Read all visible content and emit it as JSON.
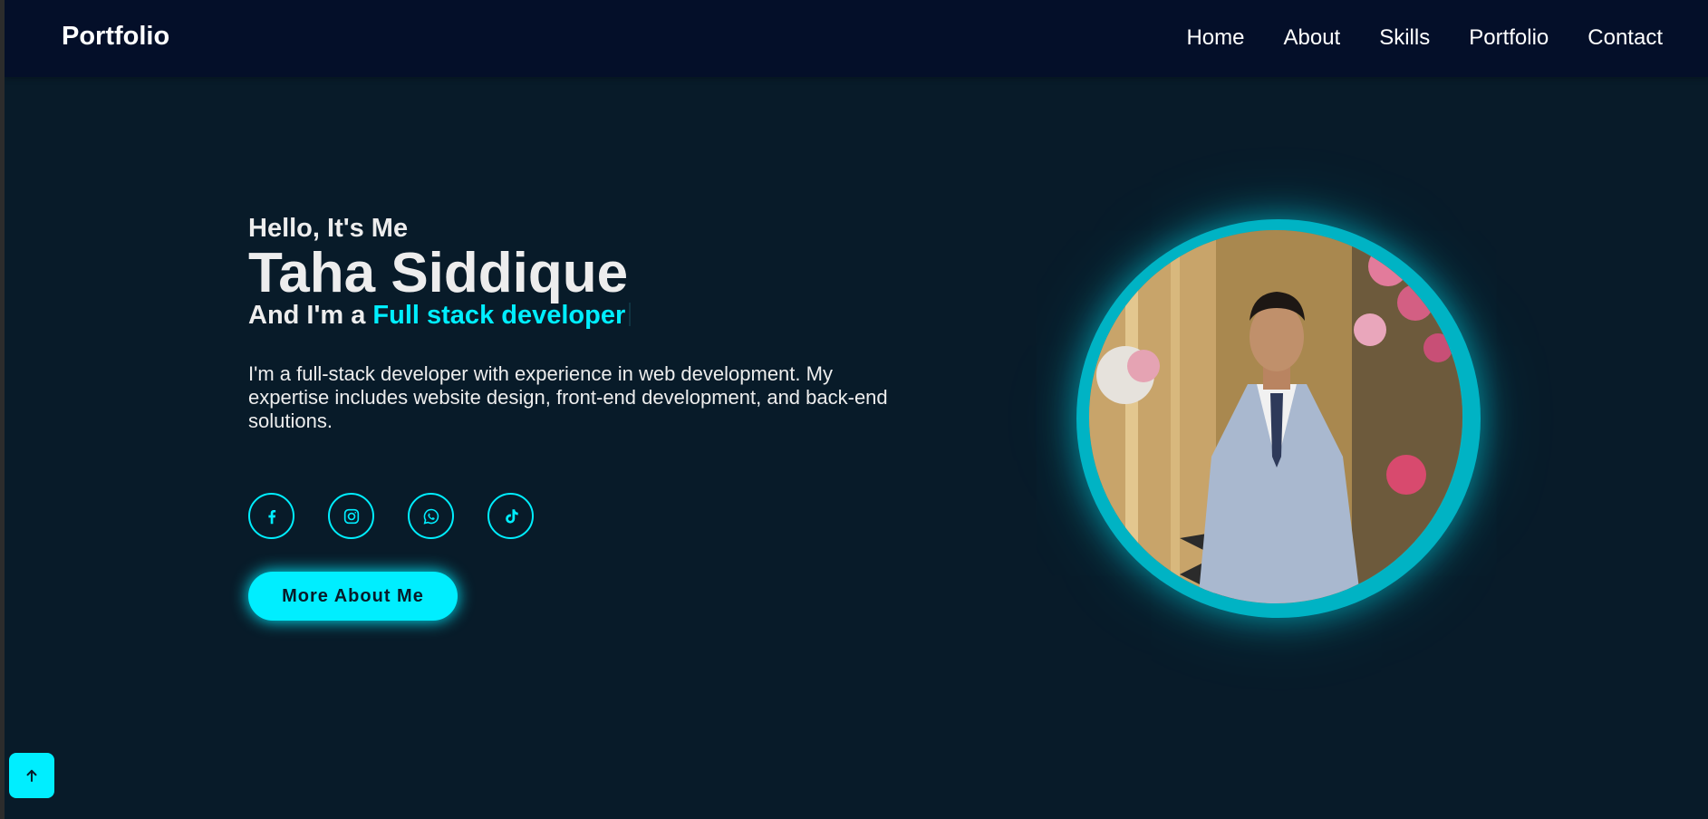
{
  "navbar": {
    "logo": "Portfolio",
    "links": [
      "Home",
      "About",
      "Skills",
      "Portfolio",
      "Contact"
    ]
  },
  "hero": {
    "greeting": "Hello, It's Me",
    "name": "Taha Siddique",
    "role_prefix": "And I'm a ",
    "role": "Full stack developer",
    "bio": "I'm a full-stack developer with experience in web development. My expertise includes website design, front-end development, and back-end solutions.",
    "socials": [
      {
        "icon": "facebook-icon"
      },
      {
        "icon": "instagram-icon"
      },
      {
        "icon": "whatsapp-icon"
      },
      {
        "icon": "tiktok-icon"
      }
    ],
    "button_label": "More About Me"
  },
  "scroll_top": {
    "icon": "arrow-up-icon"
  },
  "colors": {
    "background": "#081b29",
    "navbar": "#040f29",
    "accent": "#00eeff",
    "text": "#ededed"
  }
}
